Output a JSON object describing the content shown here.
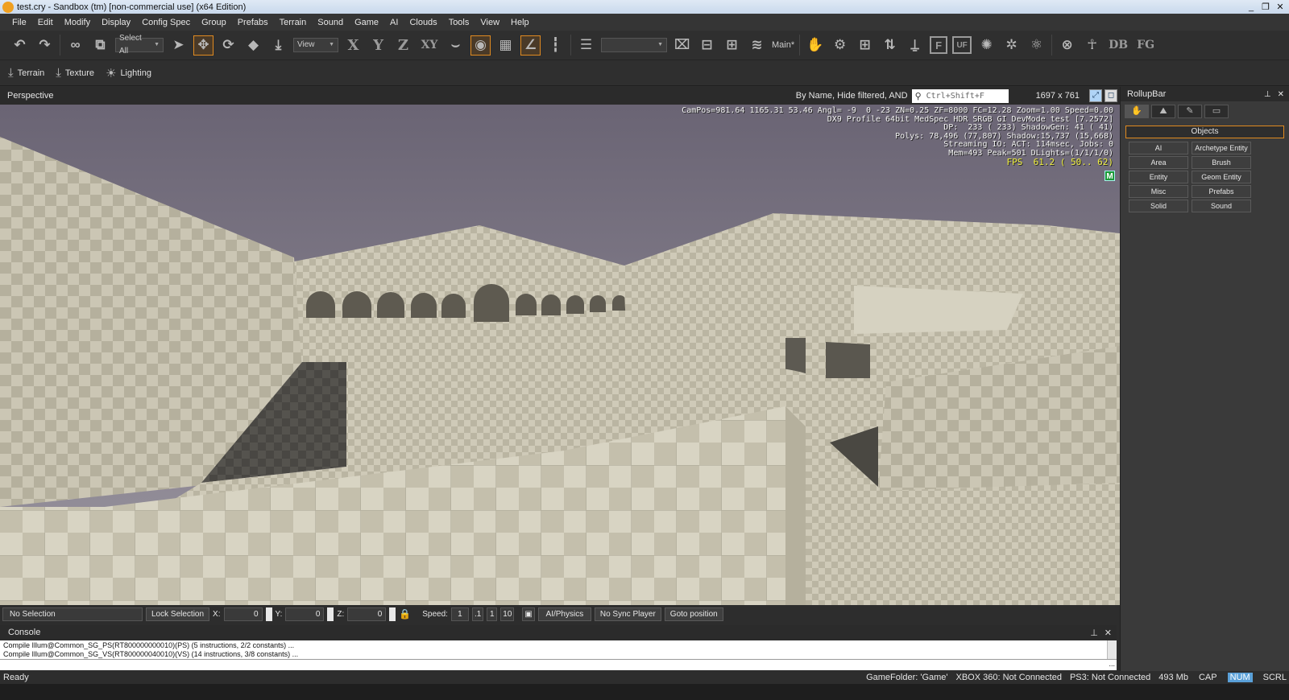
{
  "window": {
    "title": "test.cry - Sandbox (tm) [non-commercial use] (x64 Edition)",
    "controls": [
      "_",
      "❐",
      "✕"
    ]
  },
  "menu": [
    "File",
    "Edit",
    "Modify",
    "Display",
    "Config Spec",
    "Group",
    "Prefabs",
    "Terrain",
    "Sound",
    "Game",
    "AI",
    "Clouds",
    "Tools",
    "View",
    "Help"
  ],
  "toolbar": {
    "select_all": "Select All",
    "view": "View",
    "axis_x": "X",
    "axis_y": "Y",
    "axis_z": "Z",
    "axis_xy": "XY",
    "layer": "Main*",
    "letter_f": "F",
    "letter_uf": "UF",
    "letter_db": "DB",
    "letter_fg": "FG"
  },
  "toolbar2": {
    "terrain": "Terrain",
    "texture": "Texture",
    "lighting": "Lighting"
  },
  "viewport": {
    "title": "Perspective",
    "filter": "By Name, Hide filtered, AND",
    "search_placeholder": "Ctrl+Shift+F",
    "resolution": "1697 x 761",
    "hud": [
      "CamPos=981.64 1165.31 53.46 Angl= -9  0 -23 ZN=0.25 ZF=8000 FC=12.28 Zoom=1.00 Speed=0.00",
      "DX9 Profile 64bit MedSpec HDR SRGB GI DevMode test [7.2572]",
      "DP:  233 ( 233) ShadowGen: 41 ( 41)",
      "Polys: 78,496 (77,807) Shadow:15,737 (15,668)",
      "Streaming IO: ACT: 114msec, Jobs: 0",
      "Mem=493 Peak=501 DLights=(1/1/1/0)"
    ],
    "fps": "FPS  61.2 ( 50.. 62)",
    "badge": "M"
  },
  "selection_bar": {
    "selection": "No Selection",
    "lock": "Lock Selection",
    "x_label": "X:",
    "x_value": "0",
    "y_label": "Y:",
    "y_value": "0",
    "z_label": "Z:",
    "z_value": "0",
    "speed_label": "Speed:",
    "speed_value": "1",
    "speed_presets": [
      ".1",
      "1",
      "10"
    ],
    "ai_physics": "AI/Physics",
    "sync": "No Sync Player",
    "goto": "Goto position"
  },
  "console": {
    "title": "Console",
    "lines": [
      "Compile Illum@Common_SG_PS(RT800000000010)(PS) (5 instructions, 2/2 constants) ...",
      "Compile Illum@Common_SG_VS(RT800000040010)(VS) (14 instructions, 3/8 constants) ..."
    ],
    "input_dots": "..."
  },
  "status": {
    "left": "Ready",
    "game_folder": "GameFolder: 'Game'",
    "xbox": "XBOX 360: Not Connected",
    "ps3": "PS3: Not Connected",
    "mem": "493 Mb",
    "cap": "CAP",
    "num": "NUM",
    "scrl": "SCRL"
  },
  "rollup": {
    "title": "RollupBar",
    "objects": "Objects",
    "buttons": [
      "AI",
      "Archetype Entity",
      "Area",
      "Brush",
      "Entity",
      "Geom Entity",
      "Misc",
      "Prefabs",
      "Solid",
      "Sound"
    ]
  }
}
